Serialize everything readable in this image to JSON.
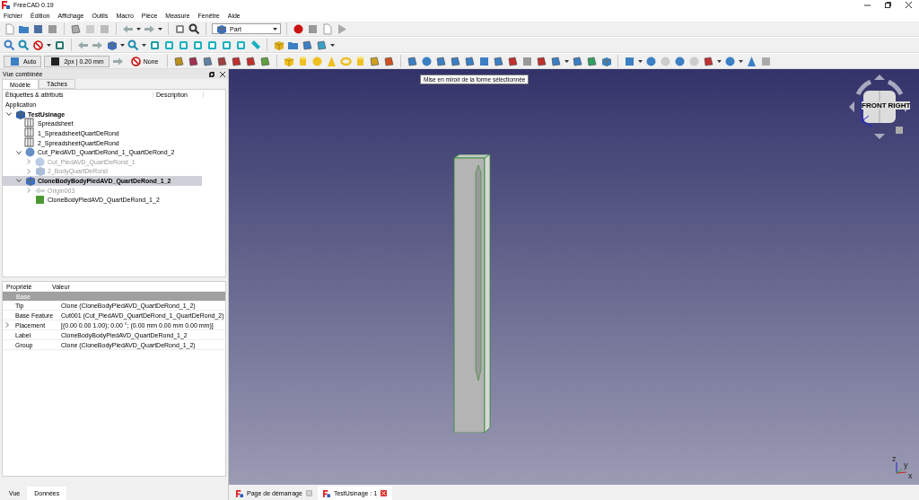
{
  "window": {
    "title": "FreeCAD 0.19"
  },
  "menu": [
    "Fichier",
    "Édition",
    "Affichage",
    "Outils",
    "Macro",
    "Pièce",
    "Measure",
    "Fenêtre",
    "Aide"
  ],
  "workbench": {
    "value": "Part"
  },
  "draw_style": {
    "auto": "Auto",
    "line": "2px | 0.20 mm",
    "none": "None"
  },
  "tooltip": "Mise en miroir de la forme sélectionnée",
  "combo_view": {
    "title": "Vue combinée",
    "tabs": [
      {
        "label": "Modèle",
        "selected": true
      },
      {
        "label": "Tâches",
        "selected": false
      }
    ],
    "columns": [
      "Étiquettes & attributs",
      "Description"
    ],
    "root": "Application",
    "tree": [
      {
        "label": "TestUsinage",
        "kind": "document",
        "expanded": true,
        "dimmed": false,
        "selected": false,
        "children": [
          {
            "label": "Spreadsheet",
            "kind": "spreadsheet",
            "dimmed": false,
            "selected": false
          },
          {
            "label": "1_SpreadsheetQuartDeRond",
            "kind": "spreadsheet",
            "dimmed": false,
            "selected": false
          },
          {
            "label": "2_SpreadsheetQuartDeRond",
            "kind": "spreadsheet",
            "dimmed": false,
            "selected": false
          },
          {
            "label": "Cut_PiedAVD_QuartDeRond_1_QuartDeRond_2",
            "kind": "cut",
            "expanded": true,
            "dimmed": false,
            "selected": false,
            "children": [
              {
                "label": "Cut_PiedAVD_QuartDeRond_1",
                "kind": "cut",
                "expanded": false,
                "dimmed": true,
                "selected": false
              },
              {
                "label": "2_BodyQuartDeRond",
                "kind": "body",
                "expanded": false,
                "dimmed": true,
                "selected": false
              }
            ]
          },
          {
            "label": "CloneBodyBodyPiedAVD_QuartDeRond_1_2",
            "kind": "body",
            "expanded": true,
            "dimmed": false,
            "selected": true,
            "children": [
              {
                "label": "Origin003",
                "kind": "origin",
                "expanded": false,
                "dimmed": true,
                "selected": false
              },
              {
                "label": "CloneBodyPiedAVD_QuartDeRond_1_2",
                "kind": "clone",
                "dimmed": false,
                "selected": false
              }
            ]
          }
        ]
      }
    ]
  },
  "properties": {
    "columns": [
      "Propriété",
      "Valeur"
    ],
    "group": "Base",
    "rows": [
      {
        "name": "Tip",
        "value": "Clone (CloneBodyPiedAVD_QuartDeRond_1_2)",
        "expandable": false
      },
      {
        "name": "Base Feature",
        "value": "Cut001 (Cut_PiedAVD_QuartDeRond_1_QuartDeRond_2)",
        "expandable": false
      },
      {
        "name": "Placement",
        "value": "[(0.00 0.00 1.00); 0.00 °; (0.00 mm  0.00 mm  0.00 mm)]",
        "expandable": true
      },
      {
        "name": "Label",
        "value": "CloneBodyBodyPiedAVD_QuartDeRond_1_2",
        "expandable": false
      },
      {
        "name": "Group",
        "value": "Clone (CloneBodyPiedAVD_QuartDeRond_1_2)",
        "expandable": false
      }
    ]
  },
  "property_tabs": [
    {
      "label": "Vue",
      "selected": false
    },
    {
      "label": "Données",
      "selected": true
    }
  ],
  "nav_cube": {
    "faces": [
      "FRONT",
      "RIGHT"
    ]
  },
  "axis_triad": {
    "x": "x",
    "y": "y",
    "z": "z"
  },
  "document_tabs": [
    {
      "label": "Page de démarrage",
      "selected": false
    },
    {
      "label": "TestUsinage : 1",
      "selected": true
    }
  ]
}
